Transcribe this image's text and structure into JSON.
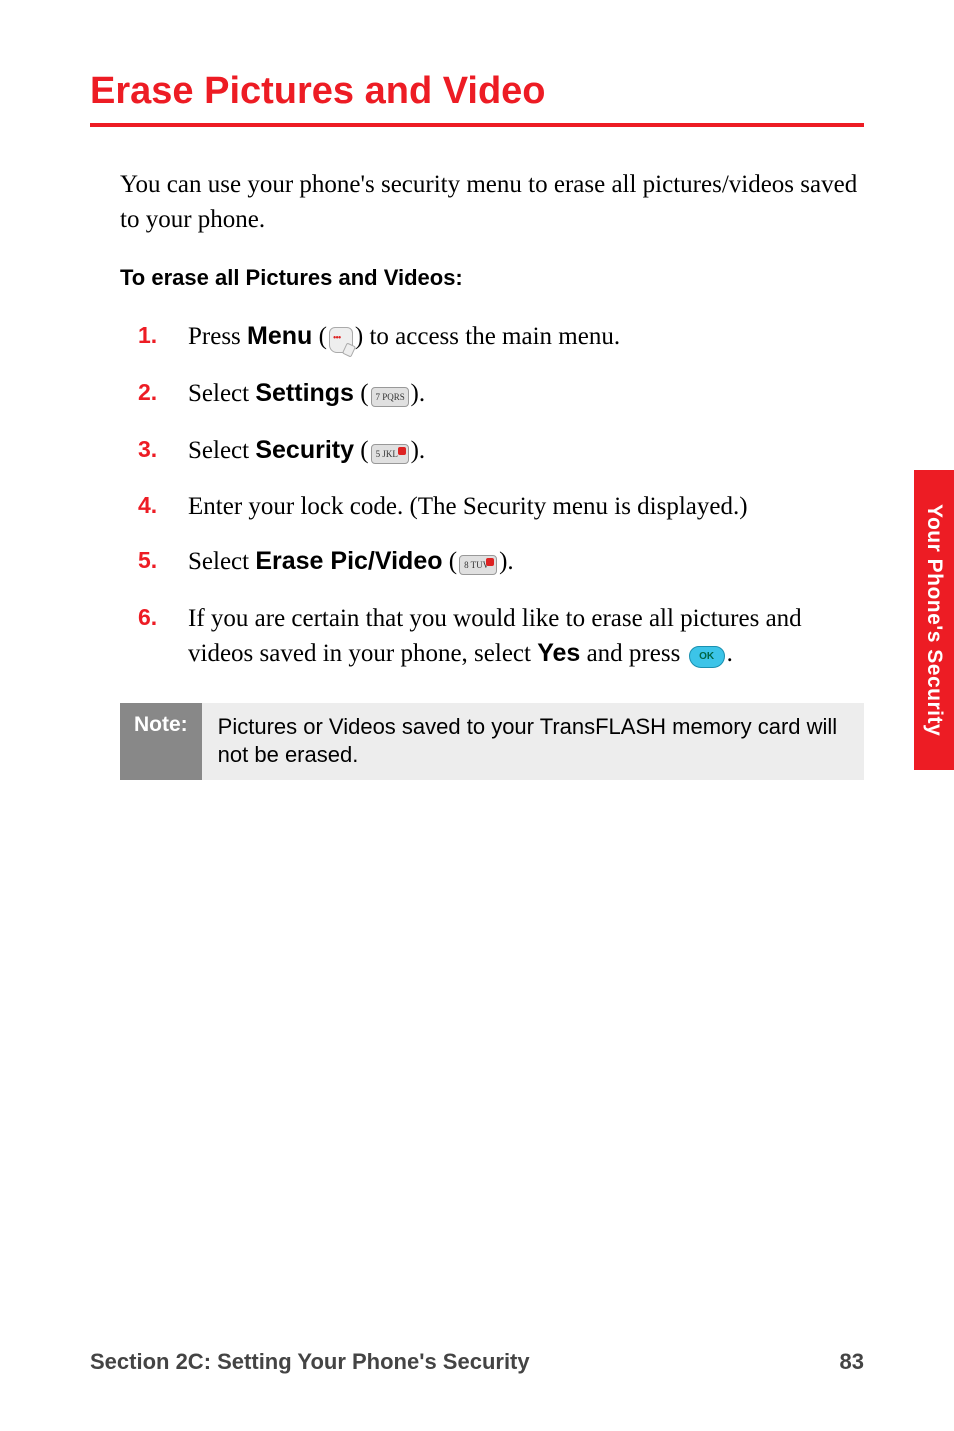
{
  "title": "Erase Pictures and Video",
  "intro": "You can use your phone's security menu to erase all pictures/videos saved to your phone.",
  "subheading": "To erase all Pictures and Videos:",
  "steps": {
    "s1_pre": "Press ",
    "s1_bold": "Menu",
    "s1_post_open": " (",
    "s1_post_close": ") to access the main menu.",
    "s2_pre": "Select ",
    "s2_bold": "Settings",
    "s2_post_open": " (",
    "s2_post_close": ").",
    "s3_pre": "Select ",
    "s3_bold": "Security",
    "s3_post_open": " (",
    "s3_post_close": ").",
    "s4": "Enter your lock code. (The Security menu is displayed.)",
    "s5_pre": "Select ",
    "s5_bold": "Erase Pic/Video",
    "s5_post_open": " (",
    "s5_post_close": ").",
    "s6_pre": "If you are certain that you would like to erase all pictures and videos saved in your phone, select ",
    "s6_bold": "Yes",
    "s6_mid": " and press ",
    "s6_end": "."
  },
  "keys": {
    "menu": "menu-key",
    "seven": "7 PQRS",
    "five": "5 JKL",
    "eight": "8 TUV",
    "ok": "OK"
  },
  "note": {
    "label": "Note:",
    "text": "Pictures or Videos saved to your TransFLASH memory card will not be erased."
  },
  "side_tab": "Your Phone's Security",
  "footer": {
    "section": "Section 2C: Setting Your Phone's Security",
    "page": "83"
  }
}
